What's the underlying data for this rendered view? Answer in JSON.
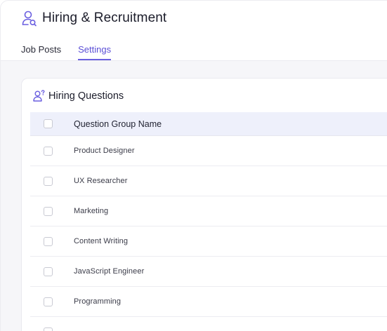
{
  "header": {
    "icon": "user-search-icon",
    "title": "Hiring & Recruitment"
  },
  "tabs": [
    {
      "label": "Job Posts",
      "active": false
    },
    {
      "label": "Settings",
      "active": true
    }
  ],
  "card": {
    "icon": "user-question-icon",
    "title": "Hiring Questions"
  },
  "table": {
    "header": "Question Group Name",
    "rows": [
      "Product Designer",
      "UX Researcher",
      "Marketing",
      "Content Writing",
      "JavaScript Engineer",
      "Programming"
    ]
  },
  "colors": {
    "accent": "#5b4fd6",
    "header_row_bg": "#eef0fb",
    "content_bg": "#f6f6f9"
  }
}
